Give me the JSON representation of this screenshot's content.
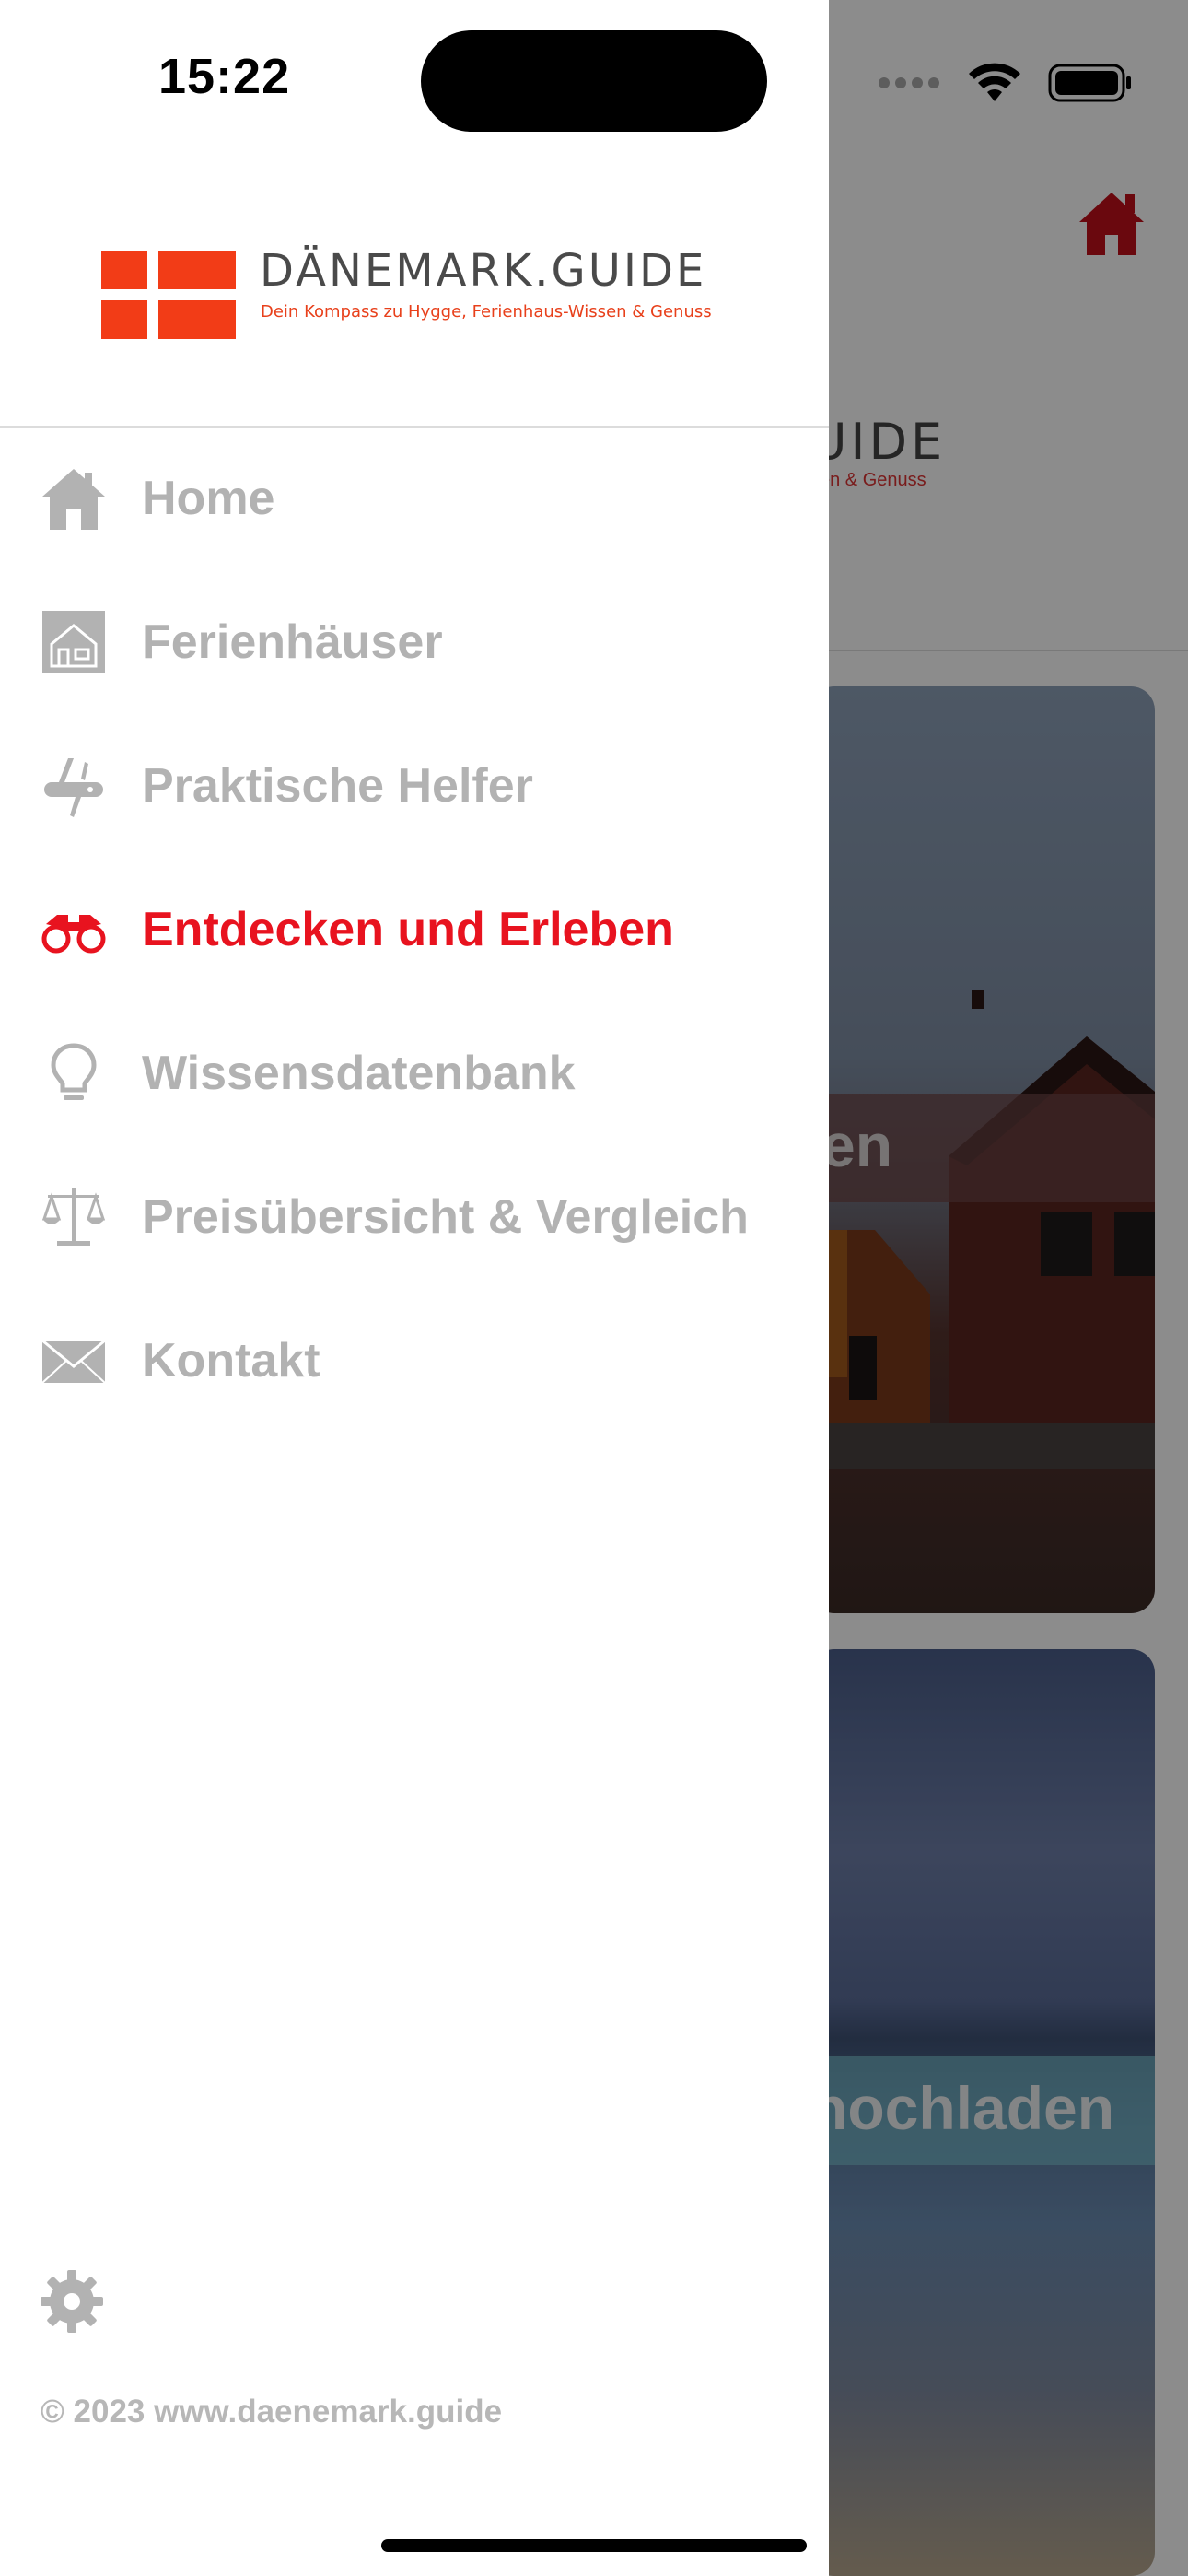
{
  "status_bar": {
    "time": "15:22"
  },
  "drawer": {
    "logo": {
      "title": "DÄNEMARK.GUIDE",
      "tagline": "Dein Kompass zu Hygge, Ferienhaus-Wissen & Genuss"
    },
    "menu": [
      {
        "label": "Home",
        "icon": "house-icon",
        "active": false
      },
      {
        "label": "Ferienhäuser",
        "icon": "holiday-house-icon",
        "active": false
      },
      {
        "label": "Praktische Helfer",
        "icon": "pocket-knife-icon",
        "active": false
      },
      {
        "label": "Entdecken und Erleben",
        "icon": "binoculars-icon",
        "active": true
      },
      {
        "label": "Wissensdatenbank",
        "icon": "lightbulb-icon",
        "active": false
      },
      {
        "label": "Preisübersicht & Vergleich",
        "icon": "scales-icon",
        "active": false
      },
      {
        "label": "Kontakt",
        "icon": "envelope-icon",
        "active": false
      }
    ],
    "footer": {
      "settings_icon": "gear-icon",
      "copyright": "© 2023 www.daenemark.guide"
    }
  },
  "background": {
    "logo_fragment": "UIDE",
    "tagline_fragment": "sen & Genuss",
    "card1_label_fragment": "en",
    "card2_label_fragment": "nochladen"
  },
  "colors": {
    "accent_active": "#e8131f",
    "logo_red": "#f23c17",
    "menu_inactive": "#b2b2b2",
    "home_button": "#c2101a"
  }
}
